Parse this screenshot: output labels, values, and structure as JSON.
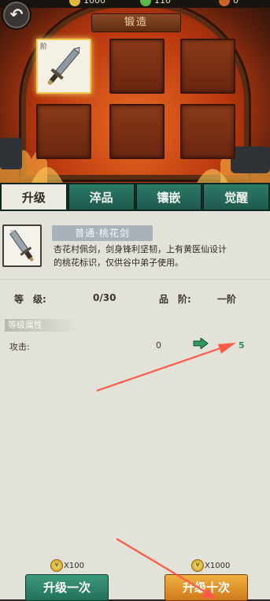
{
  "header": {
    "title": "锻造",
    "back_icon": "back-arrow-icon",
    "resources": [
      {
        "icon": "coin-icon",
        "value": "1000",
        "color": "#e3b73a"
      },
      {
        "icon": "jade-icon",
        "value": "110",
        "color": "#58b848"
      },
      {
        "icon": "hammer-icon",
        "value": "0",
        "color": "#c8642a"
      }
    ]
  },
  "slots": [
    {
      "badge": "阶",
      "has_item": true
    },
    {
      "has_item": false
    },
    {
      "has_item": false
    },
    {
      "has_item": false
    },
    {
      "has_item": false
    },
    {
      "has_item": false
    }
  ],
  "tabs": [
    {
      "label": "升级",
      "selected": true
    },
    {
      "label": "淬品",
      "selected": false
    },
    {
      "label": "镶嵌",
      "selected": false
    },
    {
      "label": "觉醒",
      "selected": false
    }
  ],
  "item": {
    "name": "普通·桃花剑",
    "description": "杏花村佩剑，剑身锋利坚韧，上有黄医仙设计的桃花标识，仅供谷中弟子使用。"
  },
  "stats": {
    "level_label": "等　级:",
    "level_value": "0/30",
    "rank_label": "品　阶:",
    "rank_value": "一阶"
  },
  "attributes": {
    "section_title": "等级属性",
    "rows": [
      {
        "label": "攻击:",
        "current": "0",
        "next": "5"
      }
    ]
  },
  "actions": {
    "upgrade_one": {
      "label": "升级一次",
      "cost": "X100"
    },
    "upgrade_ten": {
      "label": "升级十次",
      "cost": "X1000"
    }
  },
  "colors": {
    "tab_active_bg": "#ecebe2",
    "tab_bg": "#2d7a68",
    "accent_green": "#3a8f78",
    "button_orange": "#e59a2e",
    "arrow_red": "#ff5a48"
  }
}
